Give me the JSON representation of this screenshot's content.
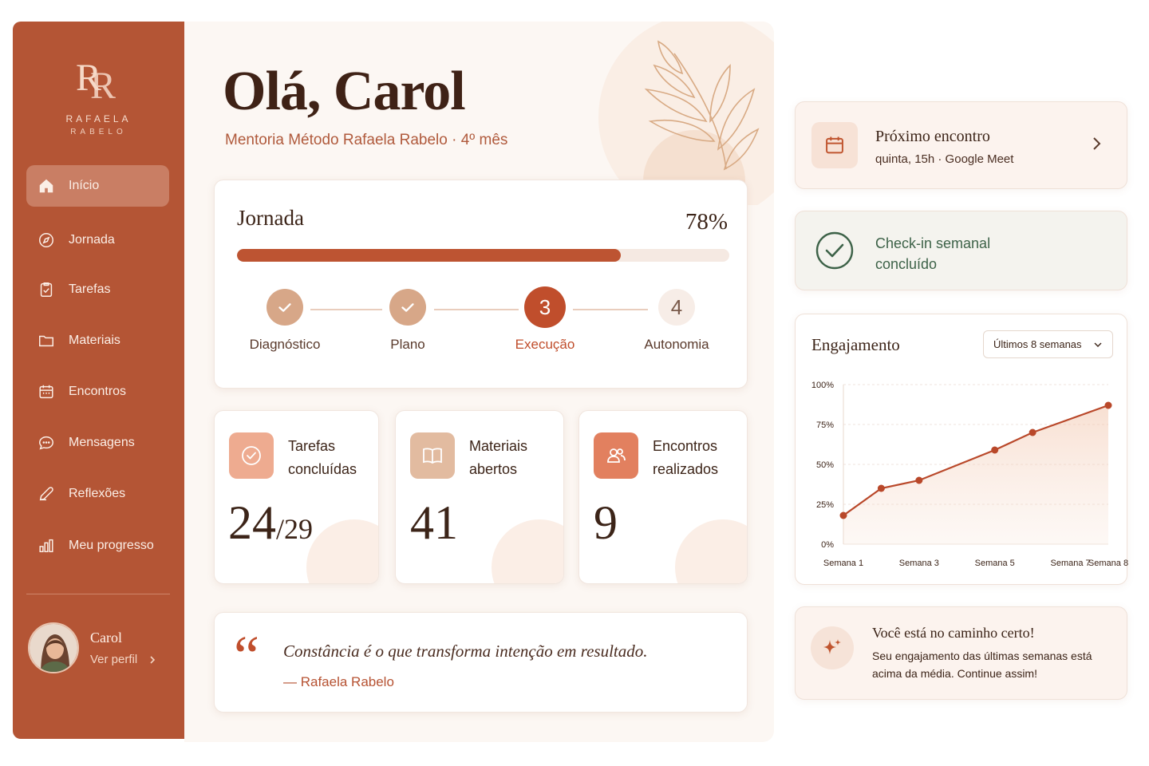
{
  "brand": {
    "monogram": "RR",
    "name": "RAFAELA",
    "surname": "RABELO"
  },
  "sidebar": {
    "items": [
      {
        "label": "Início",
        "icon": "home-icon",
        "active": true
      },
      {
        "label": "Jornada",
        "icon": "compass-icon"
      },
      {
        "label": "Tarefas",
        "icon": "clipboard-check-icon"
      },
      {
        "label": "Materiais",
        "icon": "folder-icon"
      },
      {
        "label": "Encontros",
        "icon": "calendar-icon"
      },
      {
        "label": "Mensagens",
        "icon": "chat-bubble-icon"
      },
      {
        "label": "Reflexões",
        "icon": "pen-icon"
      },
      {
        "label": "Meu progresso",
        "icon": "bar-chart-icon"
      }
    ],
    "profile": {
      "name": "Carol",
      "link": "Ver perfil"
    }
  },
  "header": {
    "greeting": "Olá, Carol",
    "subtitle": "Mentoria Método Rafaela Rabelo · 4º mês"
  },
  "journey": {
    "title": "Jornada",
    "percent_label": "78%",
    "progress": 0.78,
    "steps": [
      {
        "number": "1",
        "label": "Diagnóstico",
        "state": "done"
      },
      {
        "number": "2",
        "label": "Plano",
        "state": "done"
      },
      {
        "number": "3",
        "label": "Execução",
        "state": "current"
      },
      {
        "number": "4",
        "label": "Autonomia",
        "state": "todo"
      }
    ]
  },
  "stats": {
    "tasks": {
      "label_line1": "Tarefas",
      "label_line2": "concluídas",
      "value": "24",
      "total": "/29"
    },
    "materials": {
      "label_line1": "Materiais",
      "label_line2": "abertos",
      "value": "41"
    },
    "meetings": {
      "label_line1": "Encontros",
      "label_line2": "realizados",
      "value": "9"
    }
  },
  "quote": {
    "mark": "“",
    "text": "Constância é o que transforma intenção em resultado.",
    "author": "— Rafaela Rabelo"
  },
  "next_meeting": {
    "title": "Próximo encontro",
    "detail": "quinta, 15h · Google Meet"
  },
  "checkin": {
    "line1": "Check-in semanal",
    "line2": "concluído"
  },
  "engagement": {
    "title": "Engajamento",
    "filter": "Últimos 8 semanas"
  },
  "encouragement": {
    "title": "Você está no caminho certo!",
    "text": "Seu engajamento das últimas semanas está acima da média. Continue assim!"
  },
  "colors": {
    "sidebar": "#b45535",
    "accent": "#c04e2c",
    "chart_line": "#b9482a",
    "success": "#3d6248"
  },
  "chart_data": {
    "type": "area",
    "x": [
      "Semana 1",
      "Semana 2",
      "Semana 3",
      "Semana 4",
      "Semana 5",
      "Semana 6",
      "Semana 7",
      "Semana 8"
    ],
    "xticks": [
      "Semana 1",
      "Semana 3",
      "Semana 5",
      "Semana 7",
      "Semana 8"
    ],
    "series": [
      {
        "values": [
          18,
          35,
          40,
          59,
          70,
          87
        ]
      }
    ],
    "series_x_index": [
      0,
      1,
      2,
      4,
      5,
      7
    ],
    "yticks": [
      "0%",
      "25%",
      "50%",
      "75%",
      "100%"
    ],
    "ylim": [
      0,
      100
    ],
    "grid": true,
    "title": "Engajamento"
  }
}
